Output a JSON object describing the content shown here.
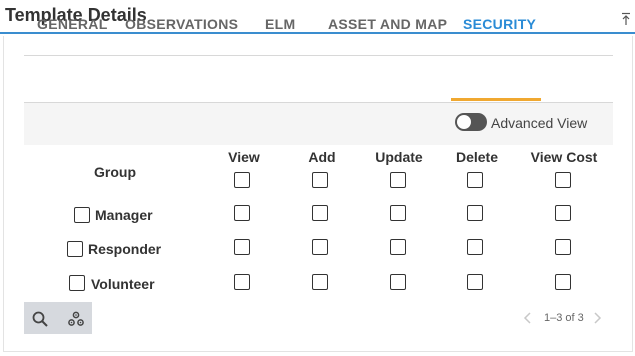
{
  "panel": {
    "title": "Template Details"
  },
  "tabs": [
    {
      "label": "GENERAL",
      "active": false
    },
    {
      "label": "OBSERVATIONS",
      "active": false
    },
    {
      "label": "ELM",
      "active": false
    },
    {
      "label": "ASSET AND MAP",
      "active": false
    },
    {
      "label": "SECURITY",
      "active": true
    }
  ],
  "advanced_view": {
    "label": "Advanced View",
    "enabled": false
  },
  "table": {
    "group_header": "Group",
    "columns": [
      "View",
      "Add",
      "Update",
      "Delete",
      "View Cost"
    ],
    "rows": [
      {
        "label": "Manager"
      },
      {
        "label": "Responder"
      },
      {
        "label": "Volunteer"
      }
    ]
  },
  "toolbar": {
    "search_icon": "search-icon",
    "settings_icon": "cogs-icon"
  },
  "pager": {
    "text": "1–3 of 3"
  },
  "colors": {
    "accent_blue": "#2a8bd6",
    "tab_underline": "#f0a830",
    "header_rule": "#3a8dcf"
  }
}
